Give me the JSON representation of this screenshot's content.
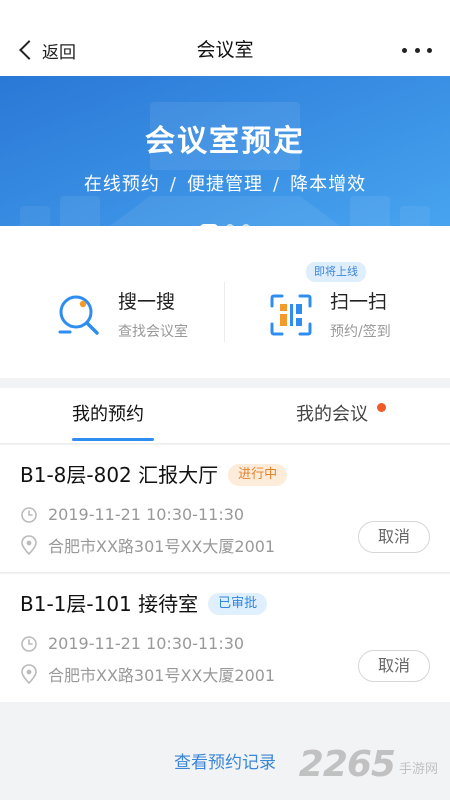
{
  "navbar": {
    "back_label": "返回",
    "title": "会议室",
    "more_icon": "more-horizontal-icon"
  },
  "banner": {
    "title": "会议室预定",
    "subtitle_items": [
      "在线预约",
      "便捷管理",
      "降本增效"
    ],
    "subtitle_separator": "/",
    "carousel_count": 3,
    "carousel_active": 1,
    "colors": {
      "top": "#2a78d6",
      "bottom": "#4aa8f2"
    }
  },
  "actions": {
    "search": {
      "title": "搜一搜",
      "desc": "查找会议室",
      "icon": "search-icon"
    },
    "scan": {
      "title": "扫一扫",
      "desc": "预约/签到",
      "icon": "scan-qr-icon",
      "badge": "即将上线"
    }
  },
  "tabs": {
    "items": [
      {
        "label": "我的预约",
        "active": true
      },
      {
        "label": "我的会议",
        "active": false,
        "has_dot": true
      }
    ]
  },
  "bookings": [
    {
      "room": "B1-8层-802 汇报大厅",
      "status": "进行中",
      "time": "2019-11-21 10:30-11:30",
      "address": "合肥市XX路301号XX大厦2001",
      "action": "取消"
    },
    {
      "room": "B1-1层-101 接待室",
      "status": "已审批",
      "time": "2019-11-21 10:30-11:30",
      "address": "合肥市XX路301号XX大厦2001",
      "action": "取消"
    }
  ],
  "footer": {
    "records_link": "查看预约记录"
  },
  "watermark": {
    "number": "2265",
    "sub": "手游网"
  },
  "colors": {
    "accent": "#2f8df0",
    "ongoing": "#e7822c",
    "approved": "#2f86df",
    "dot": "#f05a2a"
  }
}
